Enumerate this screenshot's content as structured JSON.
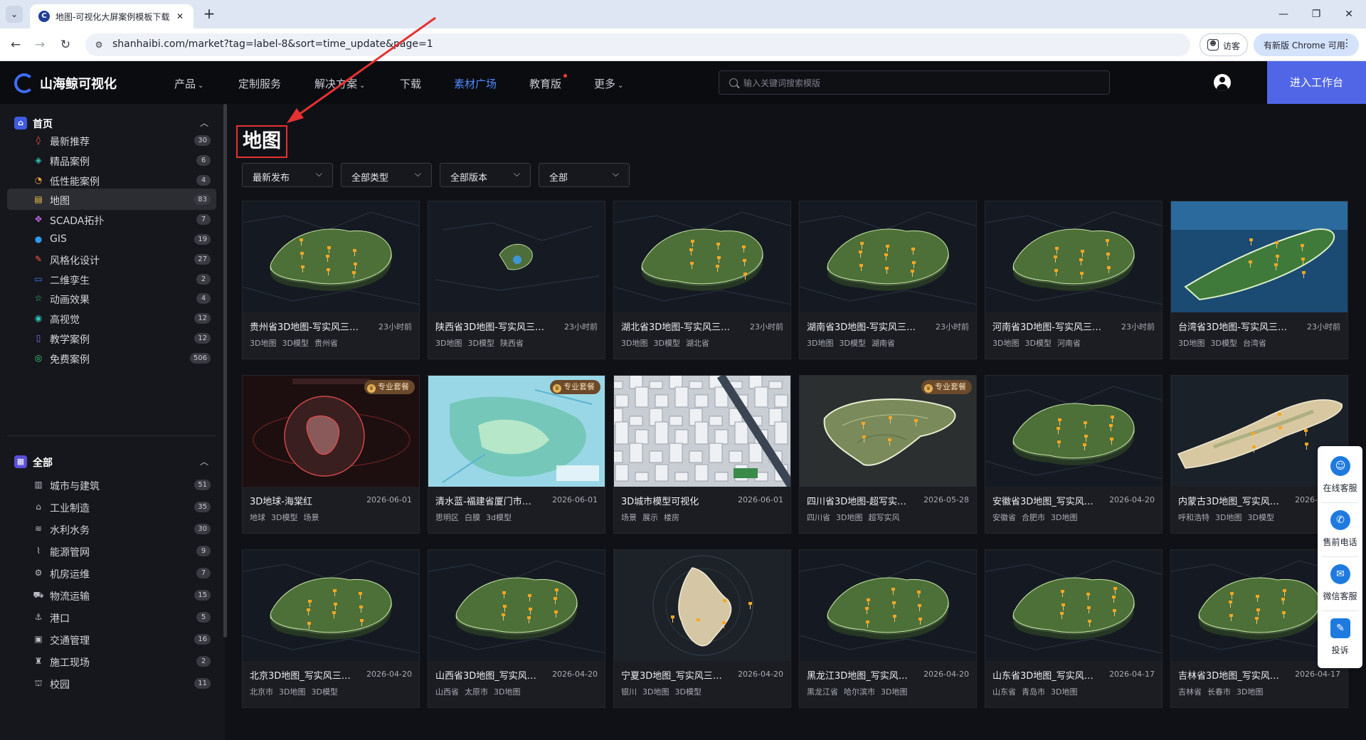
{
  "browser": {
    "tab_title": "地图-可视化大屏案例模板下载",
    "url": "shanhaibi.com/market?tag=label-8&sort=time_update&page=1",
    "guest_label": "访客",
    "update_label": "有新版 Chrome 可用",
    "close_glyph": "✕",
    "new_tab_glyph": "+",
    "menu_glyph": "⌄",
    "back_glyph": "←",
    "forward_glyph": "→",
    "reload_glyph": "↻",
    "more_glyph": "⋮",
    "min_glyph": "—",
    "max_glyph": "❐",
    "winclose_glyph": "✕"
  },
  "header": {
    "logo_text": "山海鲸可视化",
    "nav": [
      {
        "label": "产品",
        "caret": "⌄"
      },
      {
        "label": "定制服务"
      },
      {
        "label": "解决方案",
        "caret": "⌄"
      },
      {
        "label": "下载"
      },
      {
        "label": "素材广场",
        "active": true
      },
      {
        "label": "教育版"
      },
      {
        "label": "更多",
        "caret": "⌄"
      }
    ],
    "search_placeholder": "输入关键词搜索模版",
    "workbench_label": "进入工作台",
    "accent_color": "#5166e6",
    "active_nav_color": "#4f8bff"
  },
  "sidebar": {
    "home_group": "首页",
    "home_icon": "home-icon",
    "home_items": [
      {
        "label": "最新推荐",
        "count": "30",
        "icon": "flame-icon",
        "glyph": "◊",
        "color": "#ff5a4e"
      },
      {
        "label": "精品案例",
        "count": "6",
        "icon": "gem-icon",
        "glyph": "◈",
        "color": "#2fc3b5"
      },
      {
        "label": "低性能案例",
        "count": "4",
        "icon": "gauge-icon",
        "glyph": "◔",
        "color": "#f2a93b"
      },
      {
        "label": "地图",
        "count": "83",
        "icon": "map-icon",
        "glyph": "▤",
        "color": "#f4c84a",
        "active": true
      },
      {
        "label": "SCADA拓扑",
        "count": "7",
        "icon": "topology-icon",
        "glyph": "✥",
        "color": "#c86bf0"
      },
      {
        "label": "GIS",
        "count": "19",
        "icon": "globe-icon",
        "glyph": "●",
        "color": "#2f9bf0"
      },
      {
        "label": "风格化设计",
        "count": "27",
        "icon": "palette-icon",
        "glyph": "✎",
        "color": "#ff5a4e"
      },
      {
        "label": "二维孪生",
        "count": "2",
        "icon": "twin-icon",
        "glyph": "▭",
        "color": "#3f7cff"
      },
      {
        "label": "动画效果",
        "count": "4",
        "icon": "star-icon",
        "glyph": "☆",
        "color": "#3bd17c"
      },
      {
        "label": "高视觉",
        "count": "12",
        "icon": "eye-icon",
        "glyph": "◉",
        "color": "#2fc3b5"
      },
      {
        "label": "教学案例",
        "count": "12",
        "icon": "book-icon",
        "glyph": "▯",
        "color": "#7f6cf0"
      },
      {
        "label": "免费案例",
        "count": "506",
        "icon": "free-icon",
        "glyph": "◎",
        "color": "#3bd17c"
      }
    ],
    "all_group": "全部",
    "all_icon": "grid-icon",
    "all_items": [
      {
        "label": "城市与建筑",
        "count": "51",
        "icon": "building-icon",
        "glyph": "▥"
      },
      {
        "label": "工业制造",
        "count": "35",
        "icon": "factory-icon",
        "glyph": "⌂"
      },
      {
        "label": "水利水务",
        "count": "30",
        "icon": "water-icon",
        "glyph": "≋"
      },
      {
        "label": "能源管网",
        "count": "9",
        "icon": "pipeline-icon",
        "glyph": "⌇"
      },
      {
        "label": "机房运维",
        "count": "7",
        "icon": "server-icon",
        "glyph": "⚙"
      },
      {
        "label": "物流运输",
        "count": "15",
        "icon": "truck-icon",
        "glyph": "⛟"
      },
      {
        "label": "港口",
        "count": "5",
        "icon": "port-icon",
        "glyph": "⚓"
      },
      {
        "label": "交通管理",
        "count": "16",
        "icon": "traffic-icon",
        "glyph": "▣"
      },
      {
        "label": "施工现场",
        "count": "2",
        "icon": "construction-icon",
        "glyph": "♜"
      },
      {
        "label": "校园",
        "count": "11",
        "icon": "campus-icon",
        "glyph": "⛫"
      }
    ]
  },
  "main": {
    "page_title": "地图",
    "filters": [
      "最新发布",
      "全部类型",
      "全部版本",
      "全部"
    ],
    "pro_label": "专业套餐",
    "cards": [
      {
        "title": "贵州省3D地图-写实风三维…",
        "time": "23小时前",
        "tags": [
          "3D地图",
          "3D模型",
          "贵州省"
        ],
        "theme": "dark-map"
      },
      {
        "title": "陕西省3D地图-写实风三维…",
        "time": "23小时前",
        "tags": [
          "3D地图",
          "3D模型",
          "陕西省"
        ],
        "theme": "dark-small"
      },
      {
        "title": "湖北省3D地图-写实风三维…",
        "time": "23小时前",
        "tags": [
          "3D地图",
          "3D模型",
          "湖北省"
        ],
        "theme": "dark-map"
      },
      {
        "title": "湖南省3D地图-写实风三维…",
        "time": "23小时前",
        "tags": [
          "3D地图",
          "3D模型",
          "湖南省"
        ],
        "theme": "dark-map"
      },
      {
        "title": "河南省3D地图-写实风三维…",
        "time": "23小时前",
        "tags": [
          "3D地图",
          "3D模型",
          "河南省"
        ],
        "theme": "dark-map"
      },
      {
        "title": "台湾省3D地图-写实风三维…",
        "time": "23小时前",
        "tags": [
          "3D地图",
          "3D模型",
          "台湾省"
        ],
        "theme": "sea-island"
      },
      {
        "title": "3D地球-海棠红",
        "time": "2026-06-01",
        "tags": [
          "地球",
          "3D模型",
          "场景"
        ],
        "theme": "globe",
        "pro": true
      },
      {
        "title": "清水蓝-福建省厦门市…",
        "time": "2026-06-01",
        "tags": [
          "思明区",
          "白膜",
          "3d模型"
        ],
        "theme": "light-sea",
        "pro": true
      },
      {
        "title": "3D城市模型可视化",
        "time": "2026-06-01",
        "tags": [
          "场景",
          "展示",
          "楼房"
        ],
        "theme": "city"
      },
      {
        "title": "四川省3D地图-超写实…",
        "time": "2026-05-28",
        "tags": [
          "四川省",
          "3D地图",
          "超写实风"
        ],
        "theme": "terrain",
        "pro": true
      },
      {
        "title": "安徽省3D地图_写实风…",
        "time": "2026-04-20",
        "tags": [
          "安徽省",
          "合肥市",
          "3D地图"
        ],
        "theme": "dark-map"
      },
      {
        "title": "内蒙古3D地图_写实风…",
        "time": "2026-04-20",
        "tags": [
          "呼和浩特",
          "3D地图",
          "3D模型"
        ],
        "theme": "beige-map"
      },
      {
        "title": "北京3D地图_写实风三…",
        "time": "2026-04-20",
        "tags": [
          "北京市",
          "3D地图",
          "3D模型"
        ],
        "theme": "dark-map"
      },
      {
        "title": "山西省3D地图_写实风…",
        "time": "2026-04-20",
        "tags": [
          "山西省",
          "太原市",
          "3D地图"
        ],
        "theme": "dark-map"
      },
      {
        "title": "宁夏3D地图_写实风三…",
        "time": "2026-04-20",
        "tags": [
          "银川",
          "3D地图",
          "3D模型"
        ],
        "theme": "beige-ring"
      },
      {
        "title": "黑龙江3D地图_写实风…",
        "time": "2026-04-20",
        "tags": [
          "黑龙江省",
          "哈尔滨市",
          "3D地图"
        ],
        "theme": "dark-map"
      },
      {
        "title": "山东省3D地图_写实风…",
        "time": "2026-04-17",
        "tags": [
          "山东省",
          "青岛市",
          "3D地图"
        ],
        "theme": "dark-map"
      },
      {
        "title": "吉林省3D地图_写实风…",
        "time": "2026-04-17",
        "tags": [
          "吉林省",
          "长春市",
          "3D地图"
        ],
        "theme": "dark-map"
      }
    ]
  },
  "float_service": [
    {
      "label": "在线客服",
      "icon": "headset-icon",
      "glyph": "☺"
    },
    {
      "label": "售前电话",
      "icon": "phone-icon",
      "glyph": "✆"
    },
    {
      "label": "微信客服",
      "icon": "wechat-icon",
      "glyph": "✉"
    },
    {
      "label": "投诉",
      "icon": "complaint-icon",
      "glyph": "✎"
    }
  ],
  "annotation_color": "#e43232"
}
